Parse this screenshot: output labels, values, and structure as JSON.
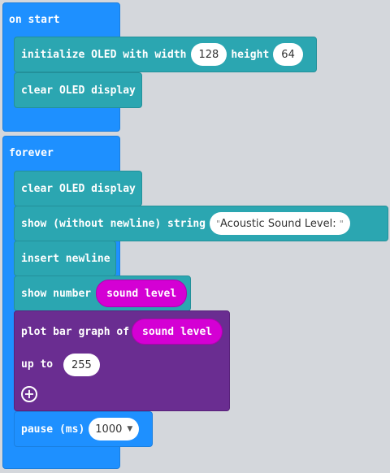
{
  "on_start": {
    "label": "on start",
    "init_block": {
      "prefix": "initialize OLED with width",
      "width_value": "128",
      "mid": "height",
      "height_value": "64"
    },
    "clear_block": {
      "label": "clear OLED display"
    }
  },
  "forever": {
    "label": "forever",
    "clear_block": {
      "label": "clear OLED display"
    },
    "show_string_block": {
      "prefix": "show (without newline) string",
      "value": "Acoustic Sound Level: "
    },
    "newline_block": {
      "label": "insert newline"
    },
    "show_number_block": {
      "prefix": "show number",
      "reporter": "sound level"
    },
    "bar_graph_block": {
      "prefix": "plot bar graph of",
      "reporter": "sound level",
      "upto_label": "up to",
      "upto_value": "255"
    },
    "pause_block": {
      "prefix": "pause (ms)",
      "value": "1000"
    }
  },
  "quote_char": "\"",
  "colors": {
    "event_blue": "#1e90ff",
    "oled_teal": "#2ba6b1",
    "graph_purple": "#6a2d91",
    "reporter_magenta": "#d400d4",
    "workspace": "#eceef1"
  },
  "icons": {
    "add": "plus-circle-icon",
    "dropdown": "dropdown-arrow-icon"
  }
}
